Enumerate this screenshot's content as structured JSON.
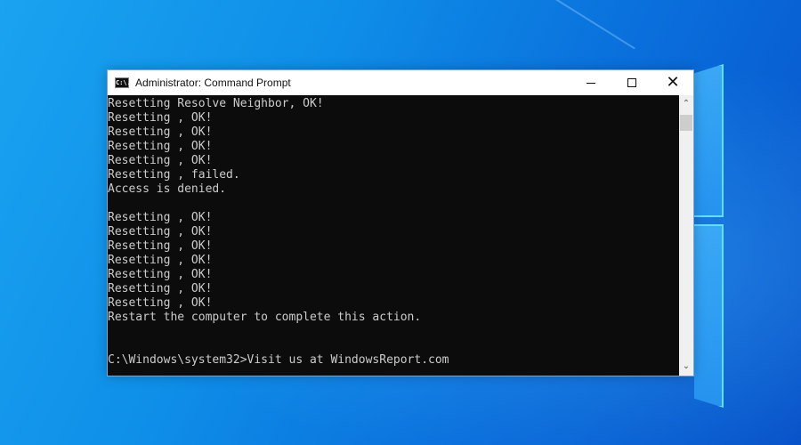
{
  "desktop": {
    "background_color": "#0e8ee8",
    "logo": "windows-logo"
  },
  "window": {
    "title": "Administrator: Command Prompt",
    "app_icon_glyph": "C:\\.",
    "controls": {
      "minimize_icon": "minimize-icon",
      "maximize_icon": "maximize-icon",
      "close_icon": "close-icon",
      "close_glyph": "✕"
    }
  },
  "console": {
    "lines": [
      "Resetting Resolve Neighbor, OK!",
      "Resetting , OK!",
      "Resetting , OK!",
      "Resetting , OK!",
      "Resetting , OK!",
      "Resetting , failed.",
      "Access is denied.",
      "",
      "Resetting , OK!",
      "Resetting , OK!",
      "Resetting , OK!",
      "Resetting , OK!",
      "Resetting , OK!",
      "Resetting , OK!",
      "Resetting , OK!",
      "Restart the computer to complete this action.",
      "",
      "",
      "C:\\Windows\\system32>Visit us at WindowsReport.com"
    ],
    "text_color": "#cccccc",
    "background_color": "#0c0c0c"
  },
  "scrollbar": {
    "up_glyph": "⌃",
    "down_glyph": "⌄"
  }
}
